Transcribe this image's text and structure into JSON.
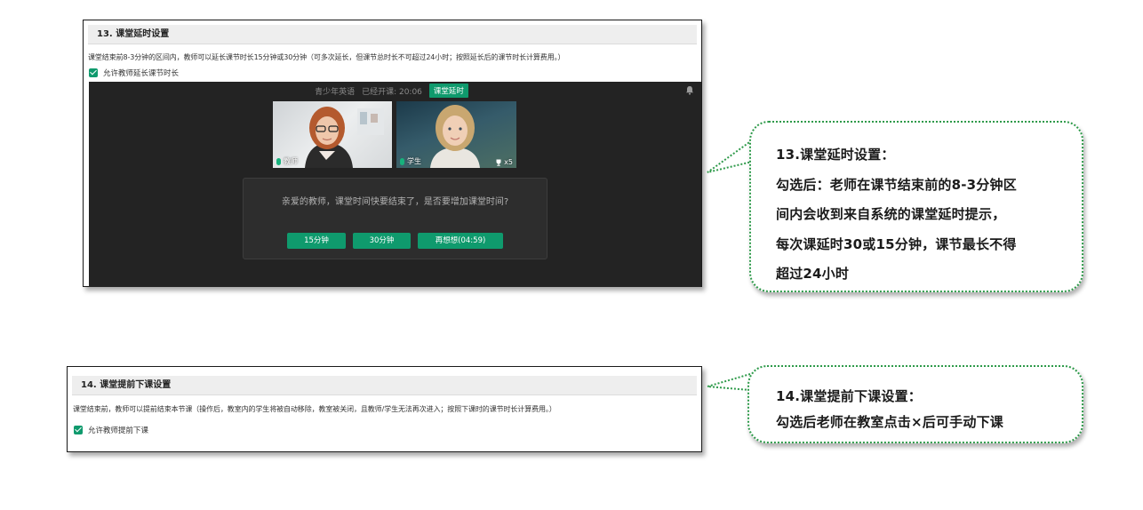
{
  "section13": {
    "title": "13. 课堂延时设置",
    "description": "课堂结束前8-3分钟的区间内，教师可以延长课节时长15分钟或30分钟（可多次延长，但课节总时长不可超过24小时；按照延长后的课节时长计算费用。）",
    "checkbox_label": "允许教师延长课节时长",
    "checkbox_checked": true,
    "classroom": {
      "course_name": "青少年英语",
      "elapsed": "已经开课: 20:06",
      "badge": "课堂延时",
      "teacher_label": "教师",
      "student_label": "学生",
      "trophy_count": "x5",
      "dialog_message": "亲爱的教师，课堂时间快要结束了，是否要增加课堂时间?",
      "buttons": [
        "15分钟",
        "30分钟",
        "再想想(04:59)"
      ]
    }
  },
  "section14": {
    "title": "14. 课堂提前下课设置",
    "description": "课堂结束前，教师可以提前结束本节课（操作后，教室内的学生将被自动移除，教室被关闭，且教师/学生无法再次进入；按照下课时的课节时长计算费用。）",
    "checkbox_label": "允许教师提前下课",
    "checkbox_checked": true
  },
  "callout13": {
    "lines": [
      "13.课堂延时设置：",
      "勾选后：老师在课节结束前的8-3分钟区",
      "间内会收到来自系统的课堂延时提示，",
      "每次课延时30或15分钟，课节最长不得",
      "超过24小时"
    ]
  },
  "callout14": {
    "lines": [
      "14.课堂提前下课设置：",
      "勾选后老师在教室点击×后可手动下课"
    ]
  },
  "colors": {
    "accent_green": "#0f9a6d",
    "callout_border": "#2e9a4a",
    "classroom_bg": "#232323"
  }
}
